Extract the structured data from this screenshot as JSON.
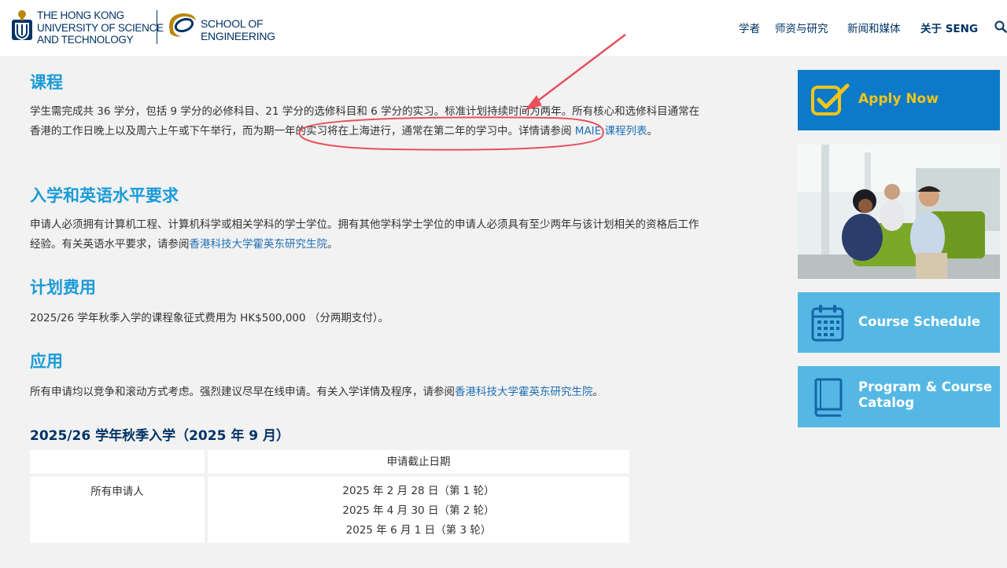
{
  "header": {
    "hkust_name": [
      "THE HONG KONG",
      "UNIVERSITY OF SCIENCE",
      "AND TECHNOLOGY"
    ],
    "school_name": [
      "SCHOOL OF",
      "ENGINEERING"
    ],
    "nav": [
      {
        "label": "学者"
      },
      {
        "label": "师资与研究"
      },
      {
        "label": "新闻和媒体"
      },
      {
        "label": "关于 SENG"
      }
    ]
  },
  "sections": {
    "curriculum": {
      "title": "课程",
      "text_before": "学生需完成共 36 学分，包括 9 学分的必修科目、21 学分的选修科目和 6 学分的实习。标准计划持续时间为两年。所有核心和选修科目通常在香港的工作日晚上以及周六上午或下午举行，而为期一年的实习将在上海进行，通常在第二年的学习中。详情请参阅 ",
      "link": "MAIE 课程列表",
      "text_after": "。"
    },
    "admission": {
      "title": "入学和英语水平要求",
      "text_before": "申请人必须拥有计算机工程、计算机科学或相关学科的学士学位。拥有其他学科学士学位的申请人必须具有至少两年与该计划相关的资格后工作经验。有关英语水平要求，请参阅",
      "link": "香港科技大学霍英东研究生院",
      "text_after": "。"
    },
    "fees": {
      "title": "计划费用",
      "text": "2025/26 学年秋季入学的课程象征式费用为 HK$500,000 （分两期支付）。"
    },
    "application": {
      "title": "应用",
      "text_before": "所有申请均以竞争和滚动方式考虑。强烈建议尽早在线申请。有关入学详情及程序，请参阅",
      "link": "香港科技大学霍英东研究生院",
      "text_after": "。"
    },
    "intake": {
      "title": "2025/26 学年秋季入学（2025 年 9 月）",
      "table": {
        "header": "申请截止日期",
        "row_label": "所有申请人",
        "dates": [
          "2025 年 2 月 28 日（第 1 轮）",
          "2025 年 4 月 30 日（第 2 轮）",
          "2025 年 6 月 1 日（第 3 轮）"
        ]
      }
    }
  },
  "sidebar": {
    "apply": "Apply Now",
    "schedule": "Course Schedule",
    "catalog": [
      "Program & Course",
      "Catalog"
    ]
  },
  "colors": {
    "heading": "#1a9bd7",
    "navy": "#003366",
    "apply_bg": "#0c7ac8",
    "apply_text": "#f5c518",
    "side_bg": "#55b8e4",
    "annotation": "#e8505b"
  }
}
